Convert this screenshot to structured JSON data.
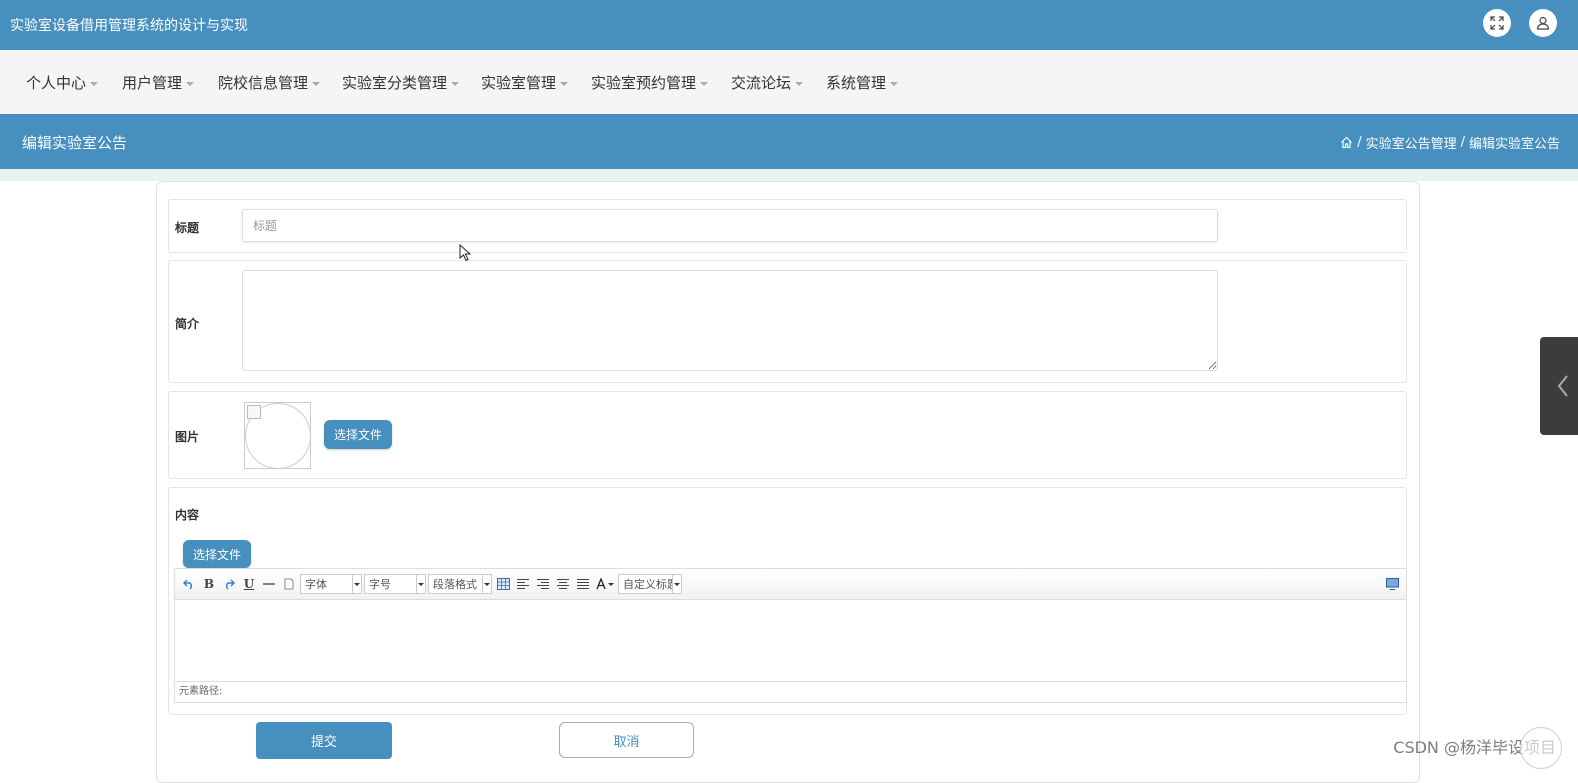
{
  "app": {
    "title": "实验室设备借用管理系统的设计与实现"
  },
  "nav": {
    "items": [
      {
        "label": "个人中心"
      },
      {
        "label": "用户管理"
      },
      {
        "label": "院校信息管理"
      },
      {
        "label": "实验室分类管理"
      },
      {
        "label": "实验室管理"
      },
      {
        "label": "实验室预约管理"
      },
      {
        "label": "交流论坛"
      },
      {
        "label": "系统管理"
      }
    ]
  },
  "page": {
    "title": "编辑实验室公告",
    "breadcrumb": {
      "sep": "/",
      "item1": "实验室公告管理",
      "item2": "编辑实验室公告"
    }
  },
  "form": {
    "title_label": "标题",
    "title_placeholder": "标题",
    "title_value": "",
    "intro_label": "简介",
    "intro_value": "",
    "image_label": "图片",
    "choose_file": "选择文件",
    "content_label": "内容",
    "submit": "提交",
    "cancel": "取消"
  },
  "editor": {
    "font_family": "字体",
    "font_size": "字号",
    "paragraph": "段落格式",
    "custom_title": "自定义标题",
    "status_label": "元素路径:"
  },
  "watermark": "CSDN @杨洋毕设项目",
  "colors": {
    "primary": "#468fbf",
    "nav_bg": "#f5f4f6"
  }
}
